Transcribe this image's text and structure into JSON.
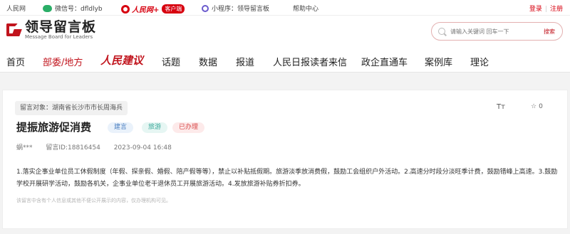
{
  "topbar": {
    "site": "人民网",
    "wechat": "微信号：dfldlyb",
    "rmw_brand": "人民网+",
    "rmw_client": "客户端",
    "mini_program": "小程序：领导留言板",
    "help": "帮助中心",
    "login": "登录",
    "register": "注册"
  },
  "header": {
    "logo_title": "领导留言板",
    "logo_sub": "Message Board for Leaders",
    "search_placeholder": "请输入关键词 回车一下",
    "search_button": "搜索"
  },
  "nav": {
    "items": [
      "首页",
      "部委/地方",
      "人民建议",
      "话题",
      "数据",
      "报道",
      "人民日报读者来信",
      "政企直通车",
      "案例库",
      "理论"
    ],
    "active_index": 1
  },
  "message": {
    "target": "留言对象：湖南省长沙市市长周海兵",
    "font_toggle": "Tт",
    "star_count": "0",
    "title": "提振旅游促消费",
    "tags": [
      "建言",
      "旅游",
      "已办理"
    ],
    "author": "蜗***",
    "message_id": "留言ID:18816454",
    "time": "2023-09-04 16:48",
    "body": "1.落实企事业单位员工休假制度（年假、探亲假、婚假、陪产假等等），禁止以补贴抵假期。旅游淡季放消费假，鼓励工会组织户外活动。2.高速分时段分淡旺季计费，鼓励错峰上高速。3.鼓励学校开展研学活动，鼓励各机关，企事业单位老干退休员工开展旅游活动。4.发放旅游补贴券折扣券。",
    "footnote": "该留言中含有个人信息或其他不便公开展示的内容，仅办理机构可见。"
  }
}
